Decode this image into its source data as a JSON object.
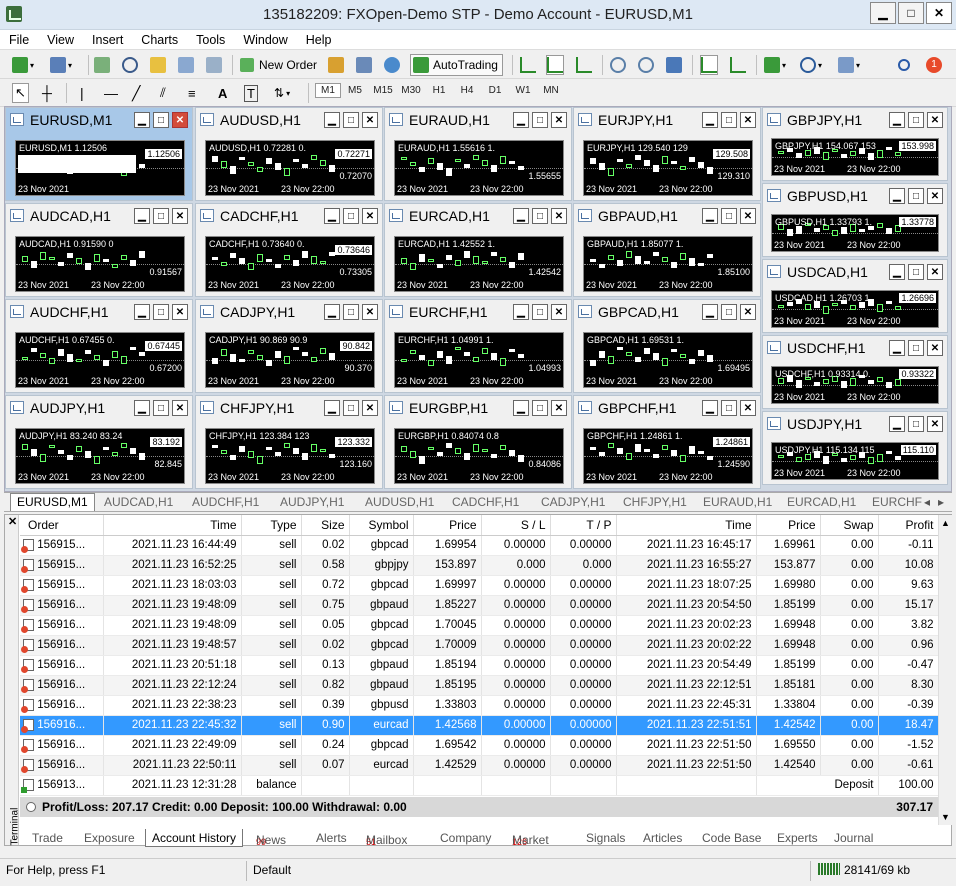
{
  "window": {
    "title": "135182209: FXOpen-Demo STP - Demo Account - EURUSD,M1",
    "min": "▁",
    "max": "□",
    "close": "✕"
  },
  "menu": [
    "File",
    "View",
    "Insert",
    "Charts",
    "Tools",
    "Window",
    "Help"
  ],
  "toolbar": {
    "new_order": "New Order",
    "autotrading": "AutoTrading",
    "notification_count": "1"
  },
  "timeframes": [
    "M1",
    "M5",
    "M15",
    "M30",
    "H1",
    "H4",
    "D1",
    "W1",
    "MN"
  ],
  "charts": [
    {
      "title": "EURUSD,M1",
      "sym": "EURUSD,M1  1.12506",
      "p1": "1.12506",
      "p2": "",
      "d1": "23 Nov 2021",
      "d2": ""
    },
    {
      "title": "AUDUSD,H1",
      "sym": "AUDUSD,H1  0.72281 0.",
      "p1": "0.72271",
      "p2": "0.72070",
      "d1": "23 Nov 2021",
      "d2": "23 Nov 22:00"
    },
    {
      "title": "EURAUD,H1",
      "sym": "EURAUD,H1  1.55616 1.",
      "p1": "",
      "p2": "1.55655",
      "d1": "23 Nov 2021",
      "d2": "23 Nov 22:00"
    },
    {
      "title": "EURJPY,H1",
      "sym": "EURJPY,H1  129.540 129",
      "p1": "129.508",
      "p2": "129.310",
      "d1": "23 Nov 2021",
      "d2": "23 Nov 22:00"
    },
    {
      "title": "GBPJPY,H1",
      "sym": "GBPJPY,H1  154.067 153",
      "p1": "153.998",
      "p2": "",
      "d1": "23 Nov 2021",
      "d2": "23 Nov 22:00"
    },
    {
      "title": "AUDCAD,H1",
      "sym": "AUDCAD,H1  0.91590 0",
      "p1": "",
      "p2": "0.91567",
      "d1": "23 Nov 2021",
      "d2": "23 Nov 22:00"
    },
    {
      "title": "CADCHF,H1",
      "sym": "CADCHF,H1  0.73640 0.",
      "p1": "0.73646",
      "p2": "0.73305",
      "d1": "23 Nov 2021",
      "d2": "23 Nov 22:00"
    },
    {
      "title": "EURCAD,H1",
      "sym": "EURCAD,H1  1.42552 1.",
      "p1": "",
      "p2": "1.42542",
      "d1": "23 Nov 2021",
      "d2": "23 Nov 22:00"
    },
    {
      "title": "GBPAUD,H1",
      "sym": "GBPAUD,H1  1.85077 1.",
      "p1": "",
      "p2": "1.85100",
      "d1": "23 Nov 2021",
      "d2": "23 Nov 22:00"
    },
    {
      "title": "GBPUSD,H1",
      "sym": "GBPUSD,H1  1.33793 1.",
      "p1": "1.33778",
      "p2": "",
      "d1": "23 Nov 2021",
      "d2": "23 Nov 22:00"
    },
    {
      "title": "AUDCHF,H1",
      "sym": "AUDCHF,H1  0.67455 0.",
      "p1": "0.67445",
      "p2": "0.67200",
      "d1": "23 Nov 2021",
      "d2": "23 Nov 22:00"
    },
    {
      "title": "CADJPY,H1",
      "sym": "CADJPY,H1  90.869 90.9",
      "p1": "90.842",
      "p2": "90.370",
      "d1": "23 Nov 2021",
      "d2": "23 Nov 22:00"
    },
    {
      "title": "EURCHF,H1",
      "sym": "EURCHF,H1  1.04991 1.",
      "p1": "",
      "p2": "1.04993",
      "d1": "23 Nov 2021",
      "d2": "23 Nov 22:00"
    },
    {
      "title": "GBPCAD,H1",
      "sym": "GBPCAD,H1  1.69531 1.",
      "p1": "",
      "p2": "1.69495",
      "d1": "23 Nov 2021",
      "d2": "23 Nov 22:00"
    },
    {
      "title": "USDCAD,H1",
      "sym": "USDCAD,H1  1.26703 1.",
      "p1": "1.26696",
      "p2": "",
      "d1": "23 Nov 2021",
      "d2": "23 Nov 22:00"
    },
    {
      "title": "AUDJPY,H1",
      "sym": "AUDJPY,H1  83.240 83.24",
      "p1": "83.192",
      "p2": "82.845",
      "d1": "23 Nov 2021",
      "d2": "23 Nov 22:00"
    },
    {
      "title": "CHFJPY,H1",
      "sym": "CHFJPY,H1  123.384 123",
      "p1": "123.332",
      "p2": "123.160",
      "d1": "23 Nov 2021",
      "d2": "23 Nov 22:00"
    },
    {
      "title": "EURGBP,H1",
      "sym": "EURGBP,H1  0.84074 0.8",
      "p1": "",
      "p2": "0.84086",
      "d1": "23 Nov 2021",
      "d2": "23 Nov 22:00"
    },
    {
      "title": "GBPCHF,H1",
      "sym": "GBPCHF,H1  1.24861 1.",
      "p1": "1.24861",
      "p2": "1.24590",
      "d1": "23 Nov 2021",
      "d2": "23 Nov 22:00"
    },
    {
      "title": "USDCHF,H1",
      "sym": "USDCHF,H1  0.93314 0.",
      "p1": "0.93322",
      "p2": "",
      "d1": "23 Nov 2021",
      "d2": "23 Nov 22:00"
    },
    {
      "title": "USDJPY,H1",
      "sym": "USDJPY,H1  115.134 115",
      "p1": "115.110",
      "p2": "",
      "d1": "23 Nov 2021",
      "d2": "23 Nov 22:00"
    }
  ],
  "chart_tabs": [
    "EURUSD,M1",
    "AUDCAD,H1",
    "AUDCHF,H1",
    "AUDJPY,H1",
    "AUDUSD,H1",
    "CADCHF,H1",
    "CADJPY,H1",
    "CHFJPY,H1",
    "EURAUD,H1",
    "EURCAD,H1",
    "EURCHF"
  ],
  "terminal": {
    "close": "✕",
    "side_label": "Terminal",
    "columns": [
      "Order",
      "Time",
      "Type",
      "Size",
      "Symbol",
      "Price",
      "S / L",
      "T / P",
      "Time",
      "Price",
      "Swap",
      "Profit"
    ],
    "rows": [
      [
        "156915...",
        "2021.11.23 16:44:49",
        "sell",
        "0.02",
        "gbpcad",
        "1.69954",
        "0.00000",
        "0.00000",
        "2021.11.23 16:45:17",
        "1.69961",
        "0.00",
        "-0.11"
      ],
      [
        "156915...",
        "2021.11.23 16:52:25",
        "sell",
        "0.58",
        "gbpjpy",
        "153.897",
        "0.000",
        "0.000",
        "2021.11.23 16:55:27",
        "153.877",
        "0.00",
        "10.08"
      ],
      [
        "156915...",
        "2021.11.23 18:03:03",
        "sell",
        "0.72",
        "gbpcad",
        "1.69997",
        "0.00000",
        "0.00000",
        "2021.11.23 18:07:25",
        "1.69980",
        "0.00",
        "9.63"
      ],
      [
        "156916...",
        "2021.11.23 19:48:09",
        "sell",
        "0.75",
        "gbpaud",
        "1.85227",
        "0.00000",
        "0.00000",
        "2021.11.23 20:54:50",
        "1.85199",
        "0.00",
        "15.17"
      ],
      [
        "156916...",
        "2021.11.23 19:48:09",
        "sell",
        "0.05",
        "gbpcad",
        "1.70045",
        "0.00000",
        "0.00000",
        "2021.11.23 20:02:23",
        "1.69948",
        "0.00",
        "3.82"
      ],
      [
        "156916...",
        "2021.11.23 19:48:57",
        "sell",
        "0.02",
        "gbpcad",
        "1.70009",
        "0.00000",
        "0.00000",
        "2021.11.23 20:02:22",
        "1.69948",
        "0.00",
        "0.96"
      ],
      [
        "156916...",
        "2021.11.23 20:51:18",
        "sell",
        "0.13",
        "gbpaud",
        "1.85194",
        "0.00000",
        "0.00000",
        "2021.11.23 20:54:49",
        "1.85199",
        "0.00",
        "-0.47"
      ],
      [
        "156916...",
        "2021.11.23 22:12:24",
        "sell",
        "0.82",
        "gbpaud",
        "1.85195",
        "0.00000",
        "0.00000",
        "2021.11.23 22:12:51",
        "1.85181",
        "0.00",
        "8.30"
      ],
      [
        "156916...",
        "2021.11.23 22:38:23",
        "sell",
        "0.39",
        "gbpusd",
        "1.33803",
        "0.00000",
        "0.00000",
        "2021.11.23 22:45:31",
        "1.33804",
        "0.00",
        "-0.39"
      ],
      [
        "156916...",
        "2021.11.23 22:45:32",
        "sell",
        "0.90",
        "eurcad",
        "1.42568",
        "0.00000",
        "0.00000",
        "2021.11.23 22:51:51",
        "1.42542",
        "0.00",
        "18.47"
      ],
      [
        "156916...",
        "2021.11.23 22:49:09",
        "sell",
        "0.24",
        "gbpcad",
        "1.69542",
        "0.00000",
        "0.00000",
        "2021.11.23 22:51:50",
        "1.69550",
        "0.00",
        "-1.52"
      ],
      [
        "156916...",
        "2021.11.23 22:50:11",
        "sell",
        "0.07",
        "eurcad",
        "1.42529",
        "0.00000",
        "0.00000",
        "2021.11.23 22:51:50",
        "1.42540",
        "0.00",
        "-0.61"
      ]
    ],
    "balance_row": {
      "order": "156913...",
      "time": "2021.11.23 12:31:28",
      "type": "balance",
      "comment": "Deposit",
      "profit": "100.00"
    },
    "summary": "Profit/Loss: 207.17  Credit: 0.00  Deposit: 100.00  Withdrawal: 0.00",
    "summary_total": "307.17",
    "tabs": [
      "Trade",
      "Exposure",
      "Account History",
      "News",
      "Alerts",
      "Mailbox",
      "Company",
      "Market",
      "Signals",
      "Articles",
      "Code Base",
      "Experts",
      "Journal"
    ],
    "news_count": "99",
    "mailbox_count": "51",
    "market_count": "126"
  },
  "status": {
    "help": "For Help, press F1",
    "profile": "Default",
    "traffic": "28141/69 kb"
  }
}
